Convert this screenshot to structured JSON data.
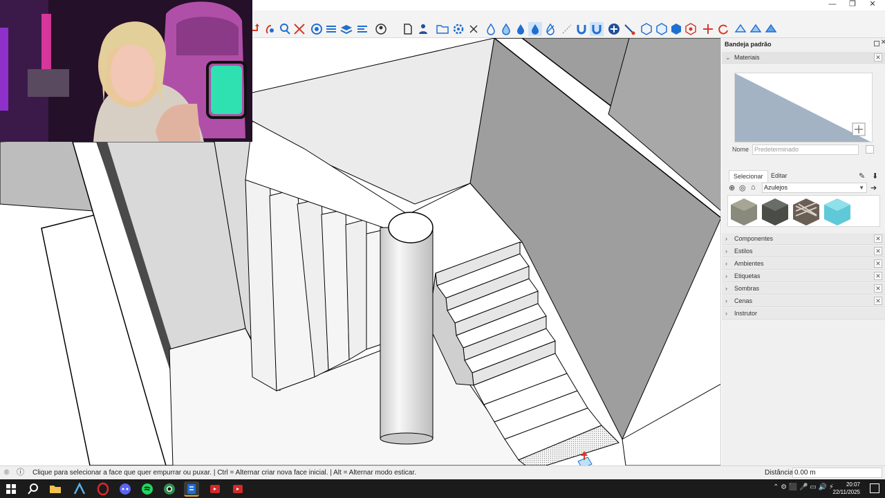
{
  "window": {
    "minimize": "—",
    "restore": "❐",
    "close": "✕"
  },
  "toolbar": {
    "icons": [
      "push-pull-icon",
      "orbit-icon",
      "pan-icon",
      "zoom-icon",
      "zoom-extents-icon",
      "section-icon",
      "layers-icon",
      "user-icon",
      "page-icon",
      "tag-icon",
      "box-select-icon",
      "close-icon",
      "drop-outline-icon",
      "drop-half-icon",
      "drop-fill-icon",
      "drop-active-icon",
      "slash-drop-icon",
      "line-tool-icon",
      "magnet-icon",
      "magnet-active-icon",
      "plus-circle-icon",
      "connect-icon",
      "hex-icon",
      "hex-outline-icon",
      "hex-blue-icon",
      "hex-red-icon",
      "axes-icon",
      "refresh-icon",
      "grid-icon",
      "grid2-icon",
      "grid3-icon"
    ],
    "accent": "#1f6fd1"
  },
  "tray": {
    "title": "Bandeja padrão",
    "materials": {
      "title": "Materiais",
      "name_label": "Nome",
      "name_placeholder": "Predeterminado",
      "tabs": [
        "Selecionar",
        "Editar"
      ],
      "library": "Azulejos",
      "swatch_colors": [
        "#8a8a7c",
        "#4a4c48",
        "#6b5f55",
        "#5fc9d8"
      ]
    },
    "panels": [
      "Componentes",
      "Estilos",
      "Ambientes",
      "Etiquetas",
      "Sombras",
      "Cenas",
      "Instrutor"
    ]
  },
  "status": {
    "message": "Clique para selecionar a face que quer empurrar ou puxar. | Ctrl = Alternar criar nova face inicial. | Alt = Alternar modo esticar.",
    "distance_label": "Distância",
    "distance_value": "0.00 m"
  },
  "taskbar": {
    "time": "20:07",
    "date": "22/11/2025",
    "apps": [
      "windows-icon",
      "search-icon",
      "file-explorer-icon",
      "autodesk-icon",
      "opera-icon",
      "discord-icon",
      "spotify-icon",
      "chrome-icon",
      "sketchup-icon",
      "app-red-icon",
      "app-red2-icon"
    ]
  }
}
